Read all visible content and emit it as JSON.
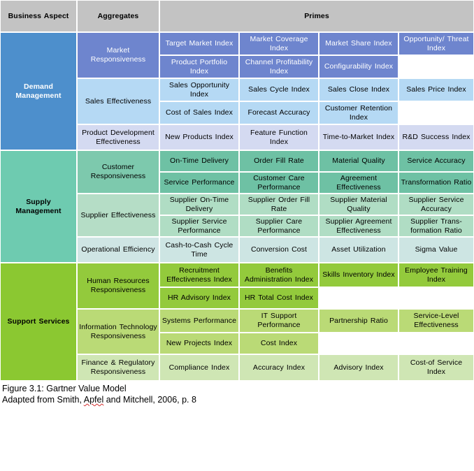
{
  "figure": {
    "caption_line1": "Figure 3.1: Gartner Value Model",
    "caption_line2_prefix": "Adapted from Smith, ",
    "caption_line2_spellword": "Apfel",
    "caption_line2_suffix": " and Mitchell, 2006, p. 8"
  },
  "header": {
    "business_aspect": "Business Aspect",
    "aggregates": "Aggregates",
    "primes": "Primes"
  },
  "colors": {
    "header_gray": "#c3c3c3",
    "demand_blue": "#4d8fcc",
    "supply_green": "#6ecbb0",
    "support_green": "#8bc831",
    "market_responsiveness": "#6e85ce",
    "sales_effectiveness": "#b5d9f4",
    "product_development": "#d4daf1",
    "customer_responsiveness": "#6ec1a4",
    "supplier_effectiveness": "#b0ddc4",
    "operational_efficiency": "#cde5e3",
    "hr_responsiveness": "#93ca3c",
    "it_responsiveness": "#bada76",
    "finance_responsiveness": "#cfe6b4",
    "empty_white": "#ffffff"
  },
  "aspects": [
    {
      "label": "Demand Management",
      "aggregates": [
        {
          "label": "Market Responsiveness",
          "rows": [
            [
              "Target Market Index",
              "Market Coverage Index",
              "Market Share Index",
              "Opportunity/ Threat Index"
            ],
            [
              "Product Portfolio Index",
              "Channel Profitability Index",
              "Configurability Index",
              ""
            ]
          ]
        },
        {
          "label": "Sales Effectiveness",
          "rows": [
            [
              "Sales Opportunity Index",
              "Sales Cycle Index",
              "Sales Close Index",
              "Sales Price Index"
            ],
            [
              "Cost of Sales Index",
              "Forecast Accuracy",
              "Customer Retention Index",
              ""
            ]
          ]
        },
        {
          "label": "Product Development Effectiveness",
          "rows": [
            [
              "New Products Index",
              "Feature Function Index",
              "Time-to-Market Index",
              "R&D Success Index"
            ]
          ]
        }
      ]
    },
    {
      "label": "Supply Management",
      "aggregates": [
        {
          "label": "Customer Responsiveness",
          "rows": [
            [
              "On-Time Delivery",
              "Order Fill Rate",
              "Material Quality",
              "Service Accuracy"
            ],
            [
              "Service Performance",
              "Customer Care Performance",
              "Agreement Effectiveness",
              "Transformation Ratio"
            ]
          ]
        },
        {
          "label": "Supplier Effectiveness",
          "rows": [
            [
              "Supplier On-Time Delivery",
              "Supplier Order Fill Rate",
              "Supplier Material Quality",
              "Supplier Service Accuracy"
            ],
            [
              "Supplier Service Performance",
              "Supplier Care Performance",
              "Supplier Agreement Effectiveness",
              "Supplier Trans- formation Ratio"
            ]
          ]
        },
        {
          "label": "Operational Efficiency",
          "rows": [
            [
              "Cash-to-Cash Cycle Time",
              "Conversion Cost",
              "Asset Utilization",
              "Sigma Value"
            ]
          ]
        }
      ]
    },
    {
      "label": "Support Services",
      "aggregates": [
        {
          "label": "Human Resources Responsiveness",
          "rows": [
            [
              "Recruitment Effectiveness Index",
              "Benefits Administration Index",
              "Skills Inventory Index",
              "Employee Training Index"
            ],
            [
              "HR Advisory Index",
              "HR Total Cost Index",
              "",
              ""
            ]
          ]
        },
        {
          "label": "Information Technology Responsiveness",
          "rows": [
            [
              "Systems Performance",
              "IT Support Performance",
              "Partnership Ratio",
              "Service-Level Effectiveness"
            ],
            [
              "New Projects Index",
              "Cost Index",
              "",
              ""
            ]
          ]
        },
        {
          "label": "Finance & Regulatory Responsiveness",
          "rows": [
            [
              "Compliance Index",
              "Accuracy Index",
              "Advisory Index",
              "Cost-of Service Index"
            ]
          ]
        }
      ]
    }
  ]
}
